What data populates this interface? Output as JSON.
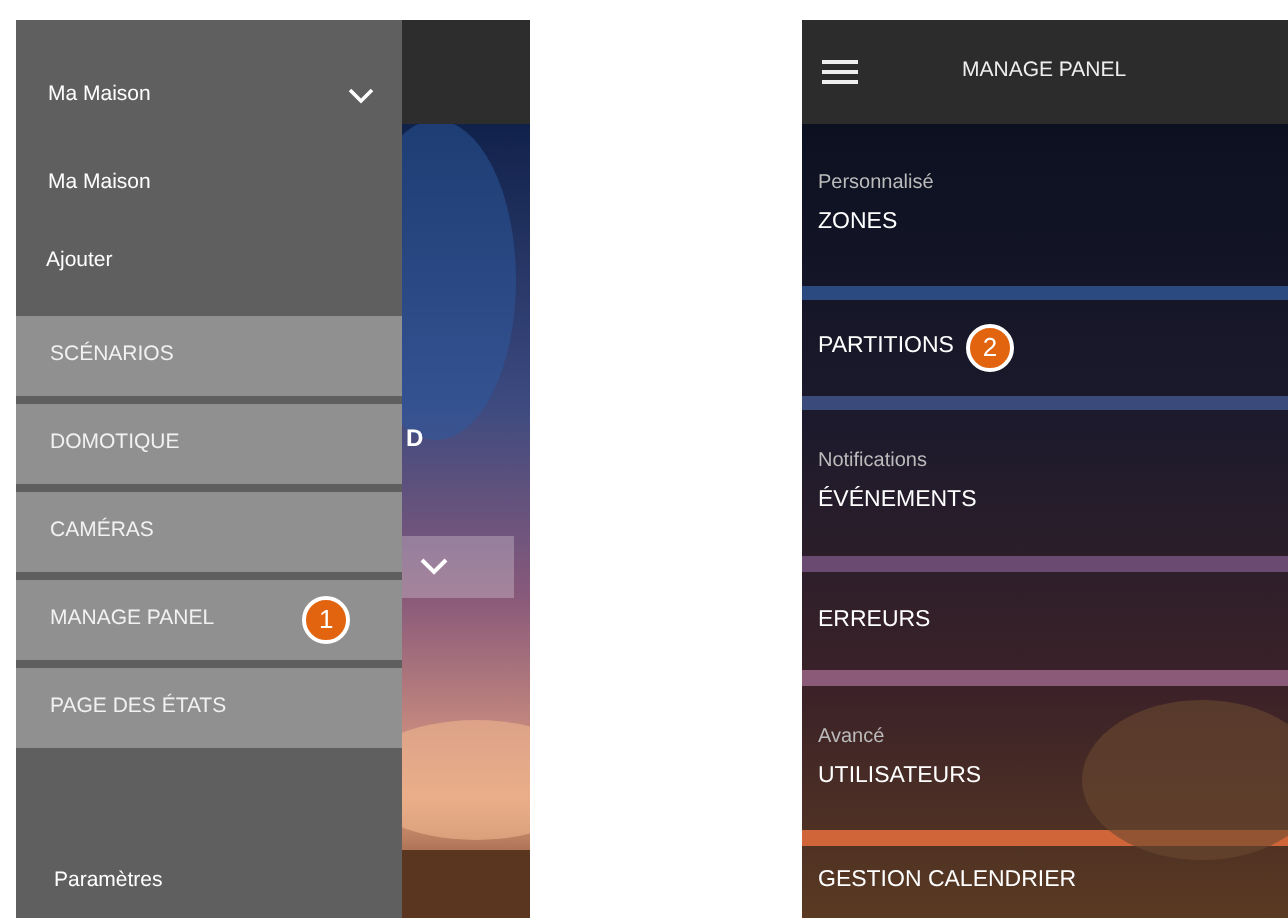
{
  "left_screen": {
    "behind_drawer": {
      "text_fragment": "D"
    },
    "drawer": {
      "account": {
        "label": "Ma Maison"
      },
      "account_items": [
        "Ma Maison",
        "Ajouter"
      ],
      "menu": [
        {
          "label": "SCÉNARIOS"
        },
        {
          "label": "DOMOTIQUE"
        },
        {
          "label": "CAMÉRAS"
        },
        {
          "label": "MANAGE PANEL",
          "badge": "1"
        },
        {
          "label": "PAGE DES ÉTATS"
        }
      ],
      "footer": "Paramètres"
    }
  },
  "right_screen": {
    "title": "MANAGE PANEL",
    "rows": [
      {
        "caption": "Personnalisé",
        "label": "ZONES"
      },
      {
        "label": "PARTITIONS",
        "badge": "2"
      },
      {
        "caption": "Notifications",
        "label": "ÉVÉNEMENTS"
      },
      {
        "label": "ERREURS"
      },
      {
        "caption": "Avancé",
        "label": "UTILISATEURS"
      },
      {
        "label": "GESTION CALENDRIER"
      }
    ]
  }
}
